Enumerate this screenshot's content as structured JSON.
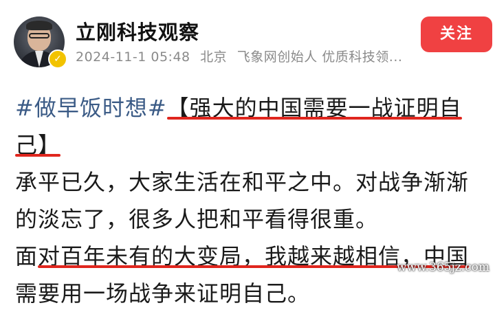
{
  "author": {
    "name": "立刚科技观察",
    "badge_icon": "verified-check-icon",
    "badge_color": "#f2c300"
  },
  "meta": {
    "timestamp": "2024-11-1 05:48",
    "location": "北京",
    "title": "飞象网创始人 优质科技领..."
  },
  "follow_button": {
    "label": "关注",
    "color": "#f04142"
  },
  "post": {
    "hashtag": "#做早饭时想#",
    "headline_part1": "【强大的中国需要一战证明自",
    "headline_part2": "己】",
    "para1_line1": "承平已久，大家生活在和平之中。对战争渐渐",
    "para1_line2": "的淡忘了，很多人把和平看得很重。",
    "para2_lead": "面",
    "para2_underlined": "对百年未有的大变局，我越来越相信，中国",
    "para2_line2": "需要用一场战争来证明自己。"
  },
  "colors": {
    "underline": "#e0261e",
    "hashtag": "#3b5b86"
  },
  "watermark": {
    "text": "www.365jz.com"
  }
}
